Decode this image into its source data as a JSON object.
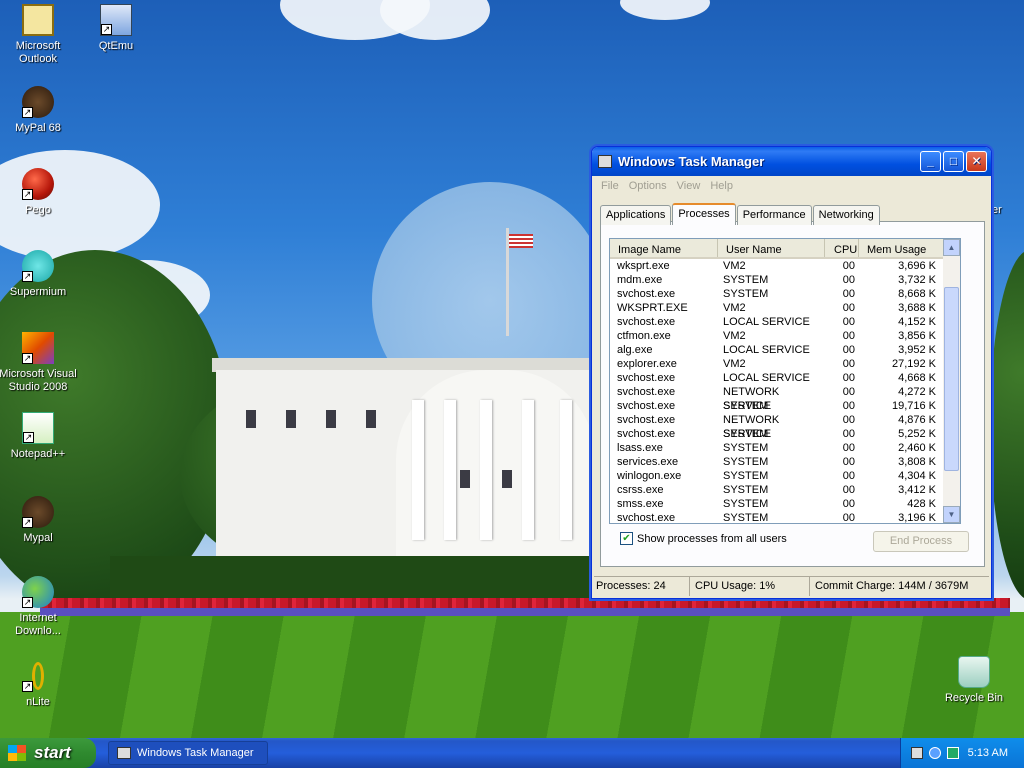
{
  "desktop": {
    "icons": [
      {
        "label": "Microsoft Outlook",
        "icon": "outlook-icon"
      },
      {
        "label": "QtEmu",
        "icon": "qtemu-icon"
      },
      {
        "label": "MyPal 68",
        "icon": "mypal-icon"
      },
      {
        "label": "Pego",
        "icon": "pego-icon"
      },
      {
        "label": "Supermium",
        "icon": "supermium-icon"
      },
      {
        "label": "Microsoft Visual Studio 2008",
        "icon": "visual-studio-icon"
      },
      {
        "label": "Notepad++",
        "icon": "notepadpp-icon"
      },
      {
        "label": "Mypal",
        "icon": "mypal-icon"
      },
      {
        "label": "Internet Downlo...",
        "icon": "internet-download-icon"
      },
      {
        "label": "nLite",
        "icon": "nlite-icon"
      },
      {
        "label": "Recycle Bin",
        "icon": "recycle-bin-icon"
      }
    ],
    "partial_label": "er"
  },
  "task_manager": {
    "title": "Windows Task Manager",
    "menu": [
      "File",
      "Options",
      "View",
      "Help"
    ],
    "tabs": [
      "Applications",
      "Processes",
      "Performance",
      "Networking"
    ],
    "active_tab": "Processes",
    "columns": [
      "Image Name",
      "User Name",
      "CPU",
      "Mem Usage"
    ],
    "processes": [
      {
        "name": "wksprt.exe",
        "user": "VM2",
        "cpu": "00",
        "mem": "3,696 K"
      },
      {
        "name": "mdm.exe",
        "user": "SYSTEM",
        "cpu": "00",
        "mem": "3,732 K"
      },
      {
        "name": "svchost.exe",
        "user": "SYSTEM",
        "cpu": "00",
        "mem": "8,668 K"
      },
      {
        "name": "WKSPRT.EXE",
        "user": "VM2",
        "cpu": "00",
        "mem": "3,688 K"
      },
      {
        "name": "svchost.exe",
        "user": "LOCAL SERVICE",
        "cpu": "00",
        "mem": "4,152 K"
      },
      {
        "name": "ctfmon.exe",
        "user": "VM2",
        "cpu": "00",
        "mem": "3,856 K"
      },
      {
        "name": "alg.exe",
        "user": "LOCAL SERVICE",
        "cpu": "00",
        "mem": "3,952 K"
      },
      {
        "name": "explorer.exe",
        "user": "VM2",
        "cpu": "00",
        "mem": "27,192 K"
      },
      {
        "name": "svchost.exe",
        "user": "LOCAL SERVICE",
        "cpu": "00",
        "mem": "4,668 K"
      },
      {
        "name": "svchost.exe",
        "user": "NETWORK SERVICE",
        "cpu": "00",
        "mem": "4,272 K"
      },
      {
        "name": "svchost.exe",
        "user": "SYSTEM",
        "cpu": "00",
        "mem": "19,716 K"
      },
      {
        "name": "svchost.exe",
        "user": "NETWORK SERVICE",
        "cpu": "00",
        "mem": "4,876 K"
      },
      {
        "name": "svchost.exe",
        "user": "SYSTEM",
        "cpu": "00",
        "mem": "5,252 K"
      },
      {
        "name": "lsass.exe",
        "user": "SYSTEM",
        "cpu": "00",
        "mem": "2,460 K"
      },
      {
        "name": "services.exe",
        "user": "SYSTEM",
        "cpu": "00",
        "mem": "3,808 K"
      },
      {
        "name": "winlogon.exe",
        "user": "SYSTEM",
        "cpu": "00",
        "mem": "4,304 K"
      },
      {
        "name": "csrss.exe",
        "user": "SYSTEM",
        "cpu": "00",
        "mem": "3,412 K"
      },
      {
        "name": "smss.exe",
        "user": "SYSTEM",
        "cpu": "00",
        "mem": "428 K"
      },
      {
        "name": "svchost.exe",
        "user": "SYSTEM",
        "cpu": "00",
        "mem": "3,196 K"
      }
    ],
    "show_all_label": "Show processes from all users",
    "show_all_checked": true,
    "end_process_label": "End Process",
    "status": {
      "processes": "Processes: 24",
      "cpu": "CPU Usage: 1%",
      "commit": "Commit Charge: 144M / 3679M"
    },
    "colors": {
      "titlebar": "#0a5fe8",
      "tab_accent": "#e68b2c",
      "window_bg": "#ece9d8"
    }
  },
  "taskbar": {
    "start_label": "start",
    "tasks": [
      "Windows Task Manager"
    ],
    "clock": "5:13 AM"
  }
}
